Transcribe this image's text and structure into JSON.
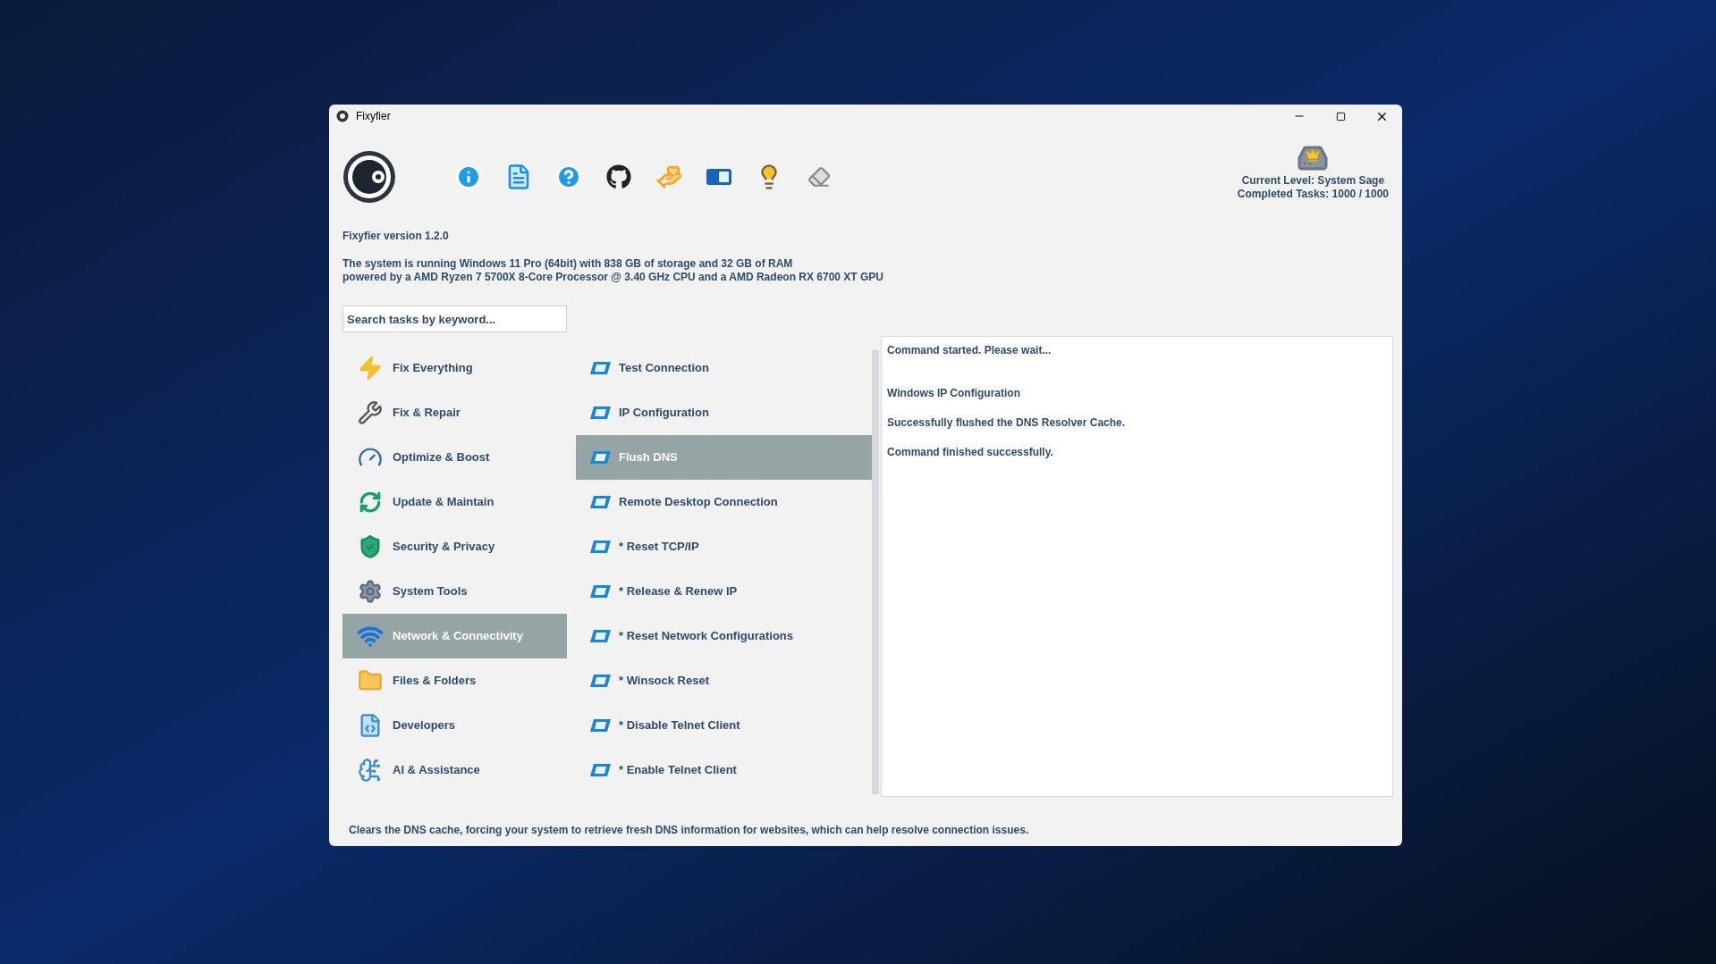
{
  "window": {
    "title": "Fixyfier"
  },
  "level": {
    "lines": [
      "Current Level: System Sage",
      "Completed Tasks: 1000 / 1000"
    ]
  },
  "version": "Fixyfier version 1.2.0",
  "system_info": [
    "The system is running Windows 11 Pro (64bit) with 838 GB of storage and 32 GB of RAM",
    "powered by a AMD Ryzen 7 5700X 8-Core Processor @ 3.40 GHz CPU and a AMD Radeon RX 6700 XT GPU"
  ],
  "search": {
    "placeholder": "Search tasks by keyword..."
  },
  "categories": [
    {
      "label": "Fix Everything",
      "selected": false
    },
    {
      "label": "Fix & Repair",
      "selected": false
    },
    {
      "label": "Optimize & Boost",
      "selected": false
    },
    {
      "label": "Update & Maintain",
      "selected": false
    },
    {
      "label": "Security & Privacy",
      "selected": false
    },
    {
      "label": "System Tools",
      "selected": false
    },
    {
      "label": "Network & Connectivity",
      "selected": true
    },
    {
      "label": "Files & Folders",
      "selected": false
    },
    {
      "label": "Developers",
      "selected": false
    },
    {
      "label": "AI & Assistance",
      "selected": false
    }
  ],
  "tasks": [
    {
      "label": "Test Connection",
      "selected": false
    },
    {
      "label": "IP Configuration",
      "selected": false
    },
    {
      "label": "Flush DNS",
      "selected": true
    },
    {
      "label": "Remote Desktop Connection",
      "selected": false
    },
    {
      "label": "* Reset TCP/IP",
      "selected": false
    },
    {
      "label": "* Release & Renew IP",
      "selected": false
    },
    {
      "label": "* Reset Network Configurations",
      "selected": false
    },
    {
      "label": "* Winsock Reset",
      "selected": false
    },
    {
      "label": "* Disable Telnet Client",
      "selected": false
    },
    {
      "label": "* Enable Telnet Client",
      "selected": false
    }
  ],
  "output": [
    "Command started. Please wait...",
    "Windows IP Configuration",
    "Successfully flushed the DNS Resolver Cache.",
    "Command finished successfully."
  ],
  "description": "Clears the DNS cache, forcing your system to retrieve fresh DNS information for websites, which can help resolve connection issues."
}
